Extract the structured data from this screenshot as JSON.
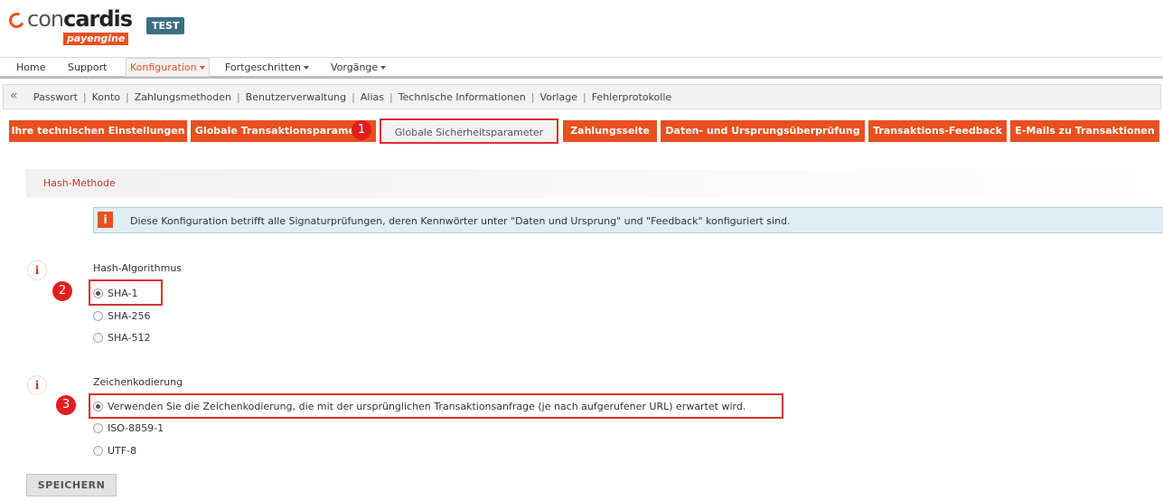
{
  "brand": {
    "name_light": "con",
    "name_bold": "cardis",
    "sub": "payengine",
    "env_badge": "TEST"
  },
  "mainnav": {
    "home": "Home",
    "support": "Support",
    "konfiguration": "Konfiguration",
    "fortgeschritten": "Fortgeschritten",
    "vorgaenge": "Vorgänge"
  },
  "subnav": {
    "back_glyph": "«",
    "items": [
      "Passwort",
      "Konto",
      "Zahlungsmethoden",
      "Benutzerverwaltung",
      "Alias",
      "Technische Informationen",
      "Vorlage",
      "Fehlerprotokolle"
    ]
  },
  "tabs": [
    "Ihre technischen Einstellungen",
    "Globale Transaktionsparameter",
    "Globale Sicherheitsparameter",
    "Zahlungsseite",
    "Daten- und Ursprungsüberprüfung",
    "Transaktions-Feedback",
    "E-Mails zu Transaktionen"
  ],
  "active_tab_index": 2,
  "section": {
    "title": "Hash-Methode"
  },
  "info": {
    "icon_glyph": "i",
    "text": "Diese Konfiguration betrifft alle Signaturprüfungen, deren Kennwörter unter \"Daten und Ursprung\" und \"Feedback\" konfiguriert sind."
  },
  "hash_algorithm": {
    "label": "Hash-Algorithmus",
    "options": [
      "SHA-1",
      "SHA-256",
      "SHA-512"
    ],
    "selected": "SHA-1"
  },
  "encoding": {
    "label": "Zeichenkodierung",
    "options": [
      "Verwenden Sie die Zeichenkodierung, die mit der ursprünglichen Transaktionsanfrage (je nach aufgerufener URL) erwartet wird.",
      "ISO-8859-1",
      "UTF-8"
    ],
    "selected": "Verwenden Sie die Zeichenkodierung, die mit der ursprünglichen Transaktionsanfrage (je nach aufgerufener URL) erwartet wird."
  },
  "help_glyph": "i",
  "markers": [
    "1",
    "2",
    "3"
  ],
  "save_label": "SPEICHERN",
  "colors": {
    "accent": "#e8501f",
    "highlight": "#d93030",
    "badge": "#3a6f82",
    "info_bg": "#e0eef3"
  },
  "icons": {
    "logo": "concardis-ring-logo",
    "info": "info-square-icon",
    "help": "info-circle-icon",
    "collapse": "double-chevron-left-icon"
  }
}
